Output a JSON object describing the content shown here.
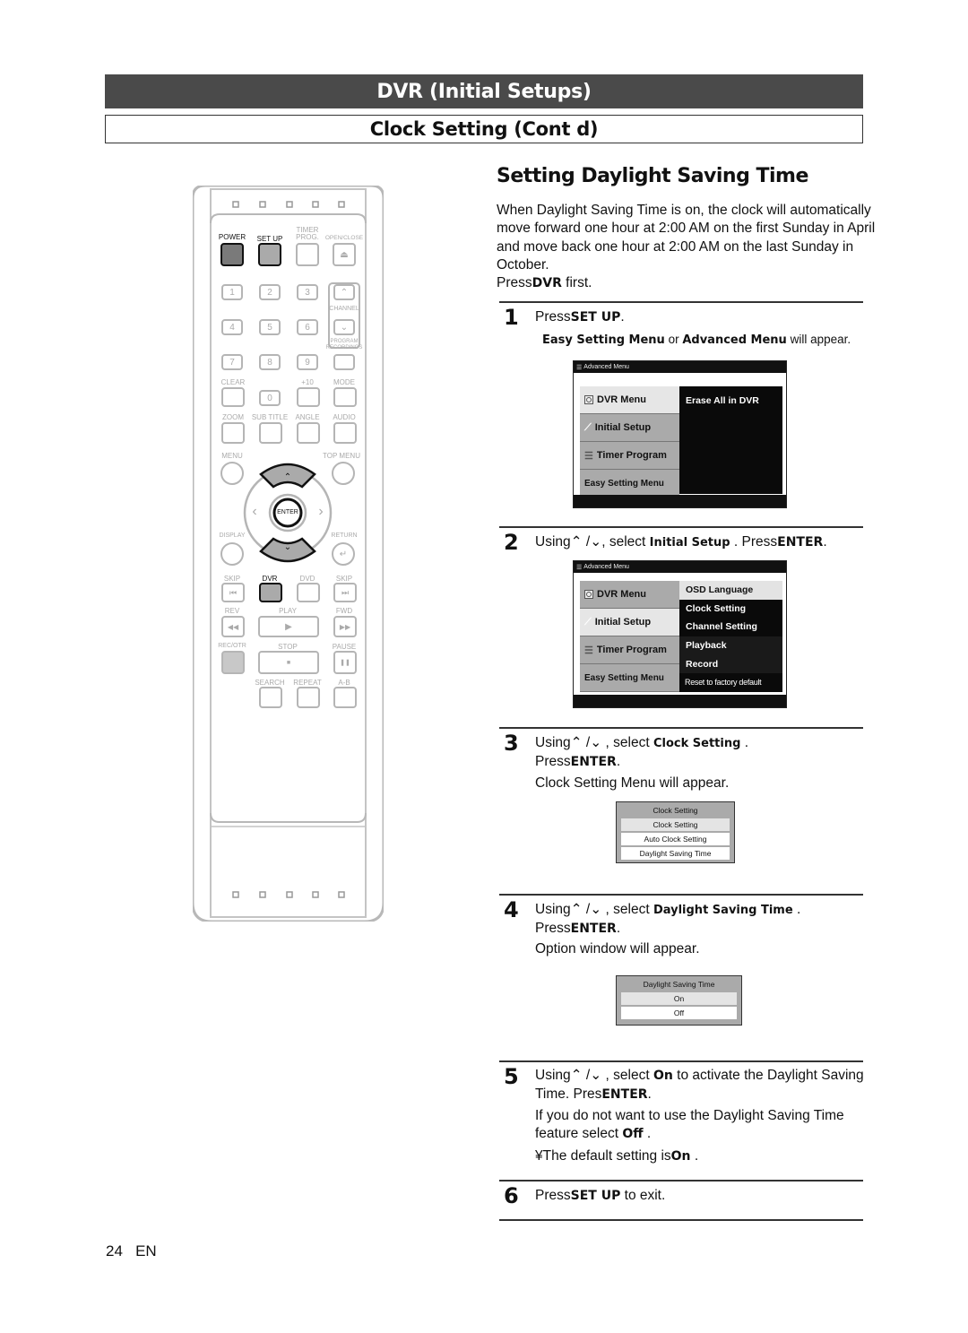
{
  "header": {
    "chapter_title": "DVR (Initial Setups)",
    "section_title": "Clock Setting (Cont d)"
  },
  "remote": {
    "labels": {
      "power": "POWER",
      "setup": "SET UP",
      "timer_prog_1": "TIMER",
      "timer_prog_2": "PROG.",
      "open_close": "OPEN/CLOSE",
      "channel": "CHANNEL",
      "program_rec_1": "PROGRAM",
      "program_rec_2": "RECORDINGS",
      "clear": "CLEAR",
      "plus10": "+10",
      "mode": "MODE",
      "zoom": "ZOOM",
      "subtitle": "SUB TITLE",
      "angle": "ANGLE",
      "audio": "AUDIO",
      "menu": "MENU",
      "top_menu": "TOP MENU",
      "enter": "ENTER",
      "display": "DISPLAY",
      "return": "RETURN",
      "skip_back": "SKIP",
      "dvr": "DVR",
      "dvd": "DVD",
      "skip_fwd": "SKIP",
      "rev": "REV",
      "play": "PLAY",
      "fwd": "FWD",
      "rec_otr": "REC/OTR",
      "stop": "STOP",
      "pause": "PAUSE",
      "search": "SEARCH",
      "repeat": "REPEAT",
      "ab": "A-B"
    },
    "digits": [
      "1",
      "2",
      "3",
      "4",
      "5",
      "6",
      "7",
      "8",
      "9",
      "0"
    ],
    "glyphs": {
      "eject": "⏏",
      "ch_up": "⌃",
      "ch_down": "⌄",
      "skip_back": "⏮",
      "skip_fwd": "⏭",
      "rev": "◀◀",
      "play": "▶",
      "fwd": "▶▶",
      "stop": "■",
      "pause": "❚❚",
      "return": "↵",
      "left": "‹",
      "right": "›"
    }
  },
  "main": {
    "title": "Setting Daylight Saving Time",
    "intro": "When Daylight Saving Time is on, the clock will automatically move forward one hour at 2:00 AM on the first Sunday in April and move back one hour at 2:00 AM on the last Sunday in October.",
    "press_first": {
      "prefix": "Press",
      "key": "DVR",
      "suffix": " first."
    },
    "steps": [
      {
        "num": "1",
        "line1": {
          "prefix": "Press",
          "key": "SET UP",
          "suffix": "."
        },
        "line2": {
          "a": "Easy Setting Menu",
          "mid": " or ",
          "b": "Advanced Menu",
          "suffix": " will appear."
        }
      },
      {
        "num": "2",
        "prefix": "Using",
        "arrows": "⌃ /⌄",
        "select": ", select ",
        "item": "Initial Setup",
        "press": " . Press",
        "key": "ENTER",
        "suffix": "."
      },
      {
        "num": "3",
        "prefix": "Using",
        "arrows": "⌃ /⌄",
        "select": " , select ",
        "item": "Clock Setting",
        "after": " .",
        "press": "Press",
        "key": "ENTER",
        "suffix": ".",
        "note": "Clock Setting Menu will appear."
      },
      {
        "num": "4",
        "prefix": "Using",
        "arrows": "⌃ /⌄",
        "select": " , select ",
        "item": "Daylight Saving Time",
        "after": " .",
        "press": "Press",
        "key": "ENTER",
        "suffix": ".",
        "note": "Option window will appear."
      },
      {
        "num": "5",
        "prefix": "Using",
        "arrows": "⌃ /⌄",
        "select": " , select ",
        "item": "On",
        "after": " to activate the Daylight Saving Time. Pres",
        "key": "ENTER",
        "suffix": ".",
        "note1_prefix": "If you do not want to use the Daylight Saving Time feature select ",
        "note1_key": "Off",
        "note1_suffix": " .",
        "note2_prefix": "¥The default setting is",
        "note2_key": "On",
        "note2_suffix": " ."
      },
      {
        "num": "6",
        "prefix": "Press",
        "key": "SET UP",
        "suffix": " to exit."
      }
    ]
  },
  "osd1": {
    "bar_title": "Advanced Menu",
    "left": [
      "DVR Menu",
      "Initial Setup",
      "Timer Program",
      "Easy Setting Menu"
    ],
    "selected_left": "DVR Menu",
    "right": [
      "Erase All in DVR"
    ]
  },
  "osd2": {
    "bar_title": "Advanced Menu",
    "left": [
      "DVR Menu",
      "Initial Setup",
      "Timer Program",
      "Easy Setting Menu"
    ],
    "selected_left": "Initial Setup",
    "right": [
      "OSD Language",
      "Clock Setting",
      "Channel Setting",
      "Playback",
      "Record",
      "Reset to factory default"
    ],
    "selected_right": "OSD Language"
  },
  "clock_menu": {
    "title": "Clock Setting",
    "items": [
      "Clock Setting",
      "Auto Clock Setting",
      "Daylight Saving Time"
    ],
    "selected": "Clock Setting"
  },
  "dst_menu": {
    "title": "Daylight Saving Time",
    "items": [
      "On",
      "Off"
    ],
    "selected": "On"
  },
  "footer": {
    "page": "24",
    "lang": "EN"
  }
}
